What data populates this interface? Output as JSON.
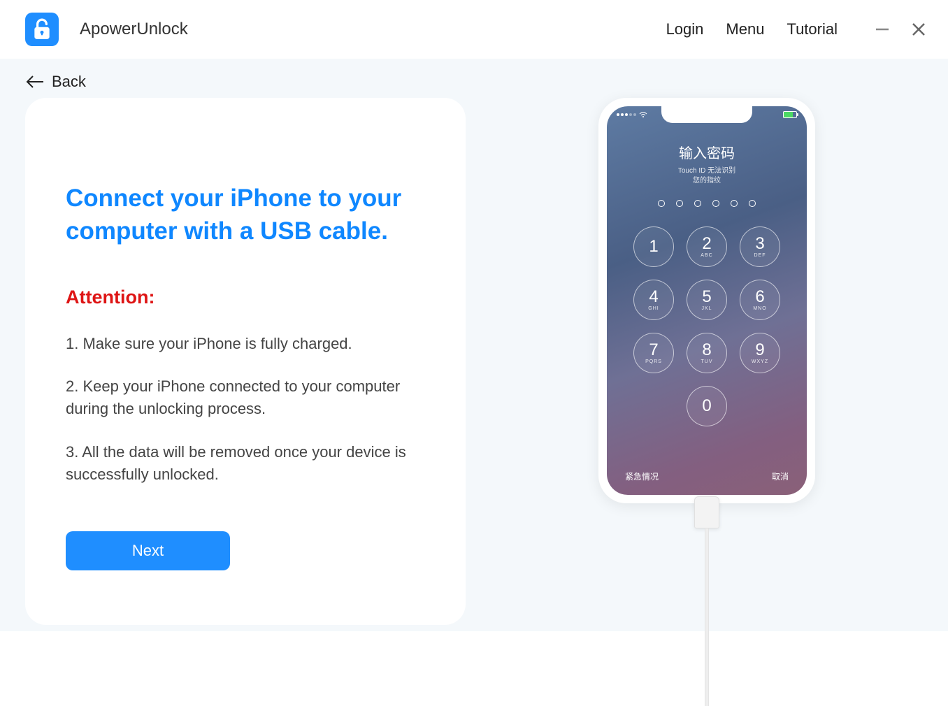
{
  "app": {
    "title": "ApowerUnlock",
    "nav": {
      "login": "Login",
      "menu": "Menu",
      "tutorial": "Tutorial"
    }
  },
  "back_label": "Back",
  "card": {
    "title": "Connect your iPhone to your computer with a USB cable.",
    "attention_label": "Attention:",
    "items": [
      "1. Make sure your iPhone is fully charged.",
      "2. Keep your iPhone connected to your computer during the unlocking process.",
      "3. All the data will be removed once your device is successfully unlocked."
    ],
    "next_label": "Next"
  },
  "phone": {
    "lock_title": "输入密码",
    "lock_sub_line1": "Touch ID 无法识别",
    "lock_sub_line2": "您的指纹",
    "emergency": "紧急情况",
    "cancel": "取消",
    "keys": [
      {
        "n": "1",
        "l": ""
      },
      {
        "n": "2",
        "l": "ABC"
      },
      {
        "n": "3",
        "l": "DEF"
      },
      {
        "n": "4",
        "l": "GHI"
      },
      {
        "n": "5",
        "l": "JKL"
      },
      {
        "n": "6",
        "l": "MNO"
      },
      {
        "n": "7",
        "l": "PQRS"
      },
      {
        "n": "8",
        "l": "TUV"
      },
      {
        "n": "9",
        "l": "WXYZ"
      },
      {
        "n": "0",
        "l": ""
      }
    ]
  }
}
